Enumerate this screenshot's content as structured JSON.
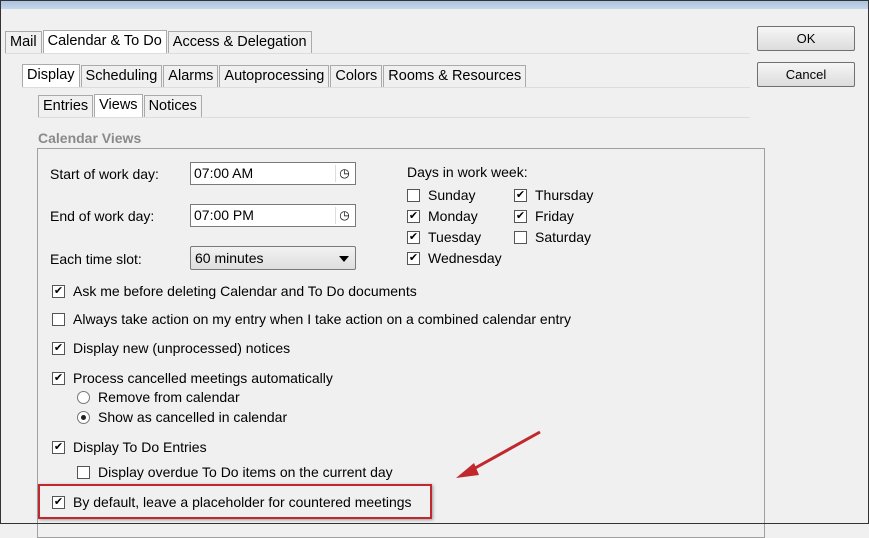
{
  "tabs_main": [
    {
      "label": "Mail"
    },
    {
      "label": "Calendar & To Do",
      "active": true
    },
    {
      "label": "Access & Delegation"
    }
  ],
  "tabs_sub": [
    {
      "label": "Display",
      "active": true
    },
    {
      "label": "Scheduling"
    },
    {
      "label": "Alarms"
    },
    {
      "label": "Autoprocessing"
    },
    {
      "label": "Colors"
    },
    {
      "label": "Rooms & Resources"
    }
  ],
  "tabs_sub2": [
    {
      "label": "Entries"
    },
    {
      "label": "Views",
      "active": true
    },
    {
      "label": "Notices"
    }
  ],
  "buttons": {
    "ok": "OK",
    "cancel": "Cancel"
  },
  "group_title": "Calendar Views",
  "fields": {
    "start_label": "Start of work day:",
    "start_value": "07:00 AM",
    "end_label": "End of work day:",
    "end_value": "07:00 PM",
    "slot_label": "Each time slot:",
    "slot_value": "60 minutes"
  },
  "days_label": "Days in work week:",
  "days": [
    {
      "label": "Sunday",
      "checked": false
    },
    {
      "label": "Monday",
      "checked": true
    },
    {
      "label": "Tuesday",
      "checked": true
    },
    {
      "label": "Wednesday",
      "checked": true
    },
    {
      "label": "Thursday",
      "checked": true
    },
    {
      "label": "Friday",
      "checked": true
    },
    {
      "label": "Saturday",
      "checked": false
    }
  ],
  "options": [
    {
      "label": "Ask me before deleting Calendar and To Do documents",
      "checked": true
    },
    {
      "label": "Always take action on my entry when I take action on a combined calendar entry",
      "checked": false
    },
    {
      "label": "Display new (unprocessed) notices",
      "checked": true
    },
    {
      "label": "Process cancelled meetings automatically",
      "checked": true
    },
    {
      "label": "Remove from calendar",
      "type": "radio",
      "checked": false
    },
    {
      "label": "Show as cancelled in calendar",
      "type": "radio",
      "checked": true
    },
    {
      "label": "Display To Do Entries",
      "checked": true
    },
    {
      "label": "Display overdue To Do items on the current day",
      "checked": false
    },
    {
      "label": "By default, leave a placeholder for countered meetings",
      "checked": true,
      "highlighted": true
    }
  ],
  "annotation_color": "#c0282d"
}
